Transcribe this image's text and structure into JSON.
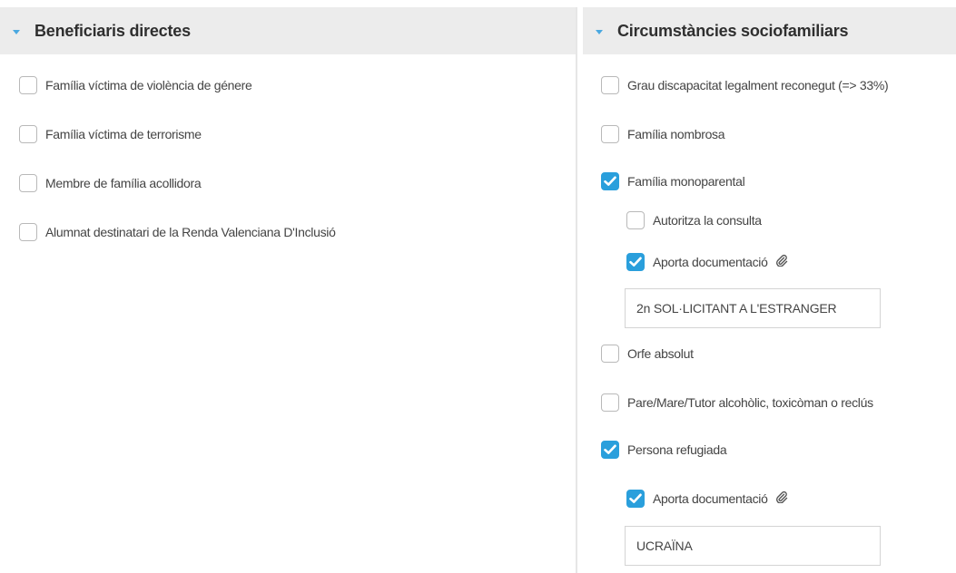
{
  "left": {
    "title": "Beneficiaris directes",
    "items": [
      {
        "label": "Família víctima de violència de génere",
        "checked": false
      },
      {
        "label": "Família víctima de terrorisme",
        "checked": false
      },
      {
        "label": "Membre de família acollidora",
        "checked": false
      },
      {
        "label": "Alumnat destinatari de la Renda Valenciana D'Inclusió",
        "checked": false
      }
    ]
  },
  "right": {
    "title": "Circumstàncies sociofamiliars",
    "grau": {
      "label": "Grau discapacitat legalment reconegut (=> 33%)",
      "checked": false
    },
    "nombrosa": {
      "label": "Família nombrosa",
      "checked": false
    },
    "monoparental": {
      "label": "Família monoparental",
      "checked": true,
      "autoritza": {
        "label": "Autoritza la consulta",
        "checked": false
      },
      "aporta": {
        "label": "Aporta documentació",
        "checked": true
      },
      "doc_value": "2n SOL·LICITANT A L'ESTRANGER"
    },
    "orfe": {
      "label": "Orfe absolut",
      "checked": false
    },
    "pare": {
      "label": "Pare/Mare/Tutor alcohòlic, toxicòman o reclús",
      "checked": false
    },
    "refugiada": {
      "label": "Persona refugiada",
      "checked": true,
      "aporta": {
        "label": "Aporta documentació",
        "checked": true
      },
      "doc_value": "UCRAÏNA"
    }
  },
  "colors": {
    "accent": "#2a9fdc",
    "header_bg": "#ececec",
    "border": "#b9b9b9"
  },
  "icons": {
    "attachment": "paperclip-icon",
    "collapse": "caret-down-icon"
  }
}
